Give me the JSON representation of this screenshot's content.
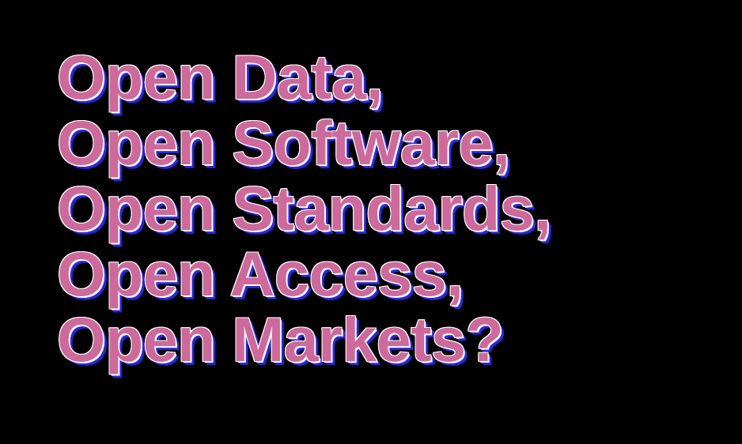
{
  "slide": {
    "background_color": "#000000",
    "text_color": "#cd6a9b",
    "outline_color": "#ffffff",
    "shadow_color": "#2a2ad8",
    "lines": [
      "Open Data,",
      "Open Software,",
      "Open Standards,",
      "Open Access,",
      "Open Markets?"
    ]
  }
}
